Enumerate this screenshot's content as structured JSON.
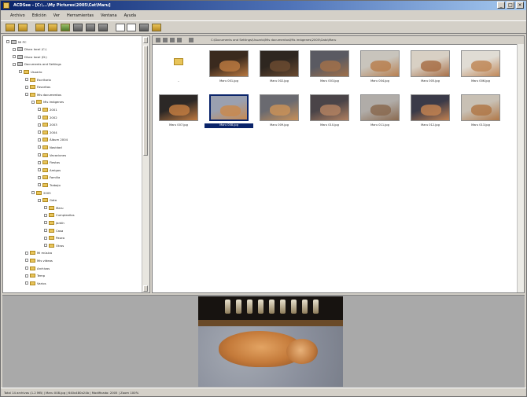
{
  "window": {
    "title": "ACDSee - [C:\\...\\My Pictures\\2005\\Cat\\Maru]"
  },
  "menu": [
    "Archivo",
    "Edición",
    "Ver",
    "Herramientas",
    "Ventana",
    "Ayuda"
  ],
  "toolbar": {
    "icons": [
      "explorer-icon",
      "browse-icon",
      "print-icon",
      "copy-icon",
      "email-icon",
      "slideshow-icon",
      "gallery-icon",
      "settings-icon",
      "view-icon",
      "zoom-icon",
      "help-icon",
      "stop-icon"
    ]
  },
  "path": {
    "text": "C:\\Documents and Settings\\Usuario\\Mis documentos\\Mis imágenes\\2005\\Gato\\Maru"
  },
  "tree": [
    {
      "label": "Mi PC",
      "depth": 0
    },
    {
      "label": "Disco local (C:)",
      "depth": 1
    },
    {
      "label": "Disco local (D:)",
      "depth": 1
    },
    {
      "label": "Documents and Settings",
      "depth": 1
    },
    {
      "label": "Usuario",
      "depth": 2
    },
    {
      "label": "Escritorio",
      "depth": 3
    },
    {
      "label": "Favoritos",
      "depth": 3
    },
    {
      "label": "Mis documentos",
      "depth": 3
    },
    {
      "label": "Mis imágenes",
      "depth": 4
    },
    {
      "label": "2001",
      "depth": 5
    },
    {
      "label": "2002",
      "depth": 5
    },
    {
      "label": "2003",
      "depth": 5
    },
    {
      "label": "2004",
      "depth": 5
    },
    {
      "label": "Álbum 2004",
      "depth": 5
    },
    {
      "label": "Navidad",
      "depth": 5
    },
    {
      "label": "Vacaciones",
      "depth": 5
    },
    {
      "label": "Fiestas",
      "depth": 5
    },
    {
      "label": "Amigos",
      "depth": 5
    },
    {
      "label": "Familia",
      "depth": 5
    },
    {
      "label": "Trabajo",
      "depth": 5
    },
    {
      "label": "2005",
      "depth": 4
    },
    {
      "label": "Gato",
      "depth": 5
    },
    {
      "label": "Maru",
      "depth": 6
    },
    {
      "label": "Cumpleaños",
      "depth": 6
    },
    {
      "label": "Jardín",
      "depth": 6
    },
    {
      "label": "Casa",
      "depth": 6
    },
    {
      "label": "Paseo",
      "depth": 6
    },
    {
      "label": "Otros",
      "depth": 6
    },
    {
      "label": "Mi música",
      "depth": 3
    },
    {
      "label": "Mis vídeos",
      "depth": 3
    },
    {
      "label": "Archivos",
      "depth": 3
    },
    {
      "label": "Temp",
      "depth": 3
    },
    {
      "label": "Varios",
      "depth": 3
    }
  ],
  "thumbnails": [
    {
      "caption": "..",
      "kind": "folder"
    },
    {
      "caption": "Maru 001.jpg",
      "kind": "photo"
    },
    {
      "caption": "Maru 002.jpg",
      "kind": "photo"
    },
    {
      "caption": "Maru 003.jpg",
      "kind": "photo"
    },
    {
      "caption": "Maru 004.jpg",
      "kind": "photo"
    },
    {
      "caption": "Maru 005.jpg",
      "kind": "photo"
    },
    {
      "caption": "Maru 006.jpg",
      "kind": "photo"
    },
    {
      "caption": "Maru 007.jpg",
      "kind": "photo"
    },
    {
      "caption": "Maru 008.jpg",
      "kind": "photo",
      "selected": true
    },
    {
      "caption": "Maru 009.jpg",
      "kind": "photo"
    },
    {
      "caption": "Maru 010.jpg",
      "kind": "photo"
    },
    {
      "caption": "Maru 011.jpg",
      "kind": "photo"
    },
    {
      "caption": "Maru 012.jpg",
      "kind": "photo"
    },
    {
      "caption": "Maru 013.jpg",
      "kind": "photo"
    }
  ],
  "status": {
    "text": "Total 14 archivos (1.2 MB)  |  Maru 008.jpg  |  640x480x24b  |  Modificado: 2005  |  Zoom 100%"
  },
  "colors": {
    "selection": "#0a246a",
    "folder": "#e8c45a",
    "window_bg": "#d4d0c8",
    "preview_bg": "#a9a9a9"
  }
}
